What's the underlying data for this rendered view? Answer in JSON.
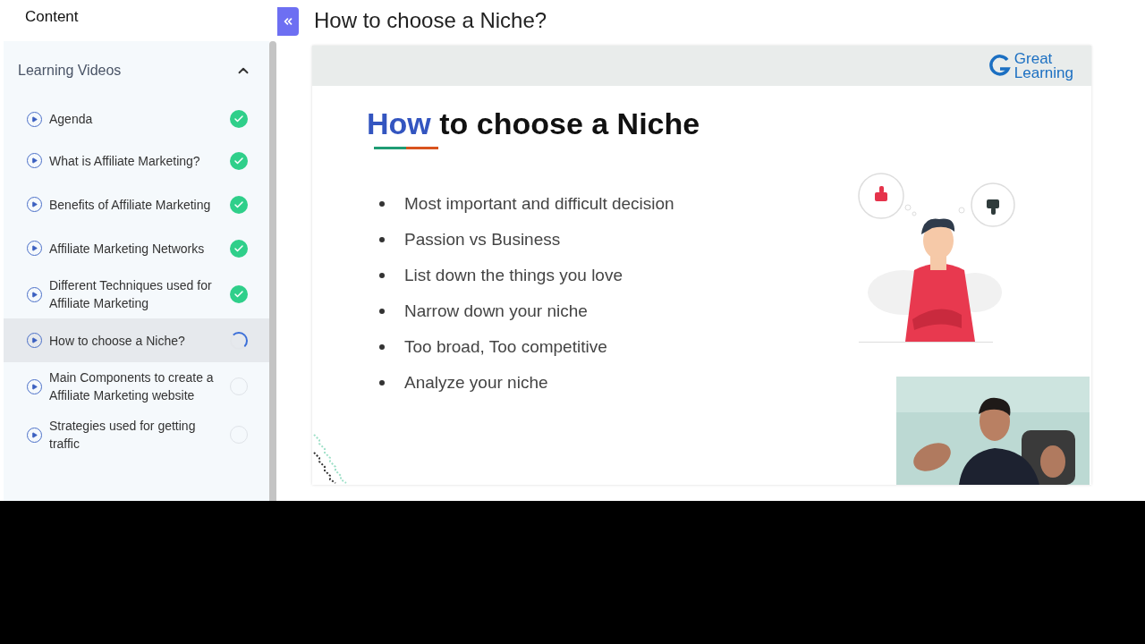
{
  "sidebar": {
    "title": "Content",
    "section": {
      "title": "Learning Videos",
      "expanded": true,
      "items": [
        {
          "label": "Agenda",
          "kind": "done",
          "selected": false
        },
        {
          "label": "What is Affiliate Marketing?",
          "kind": "done",
          "selected": false
        },
        {
          "label": "Benefits of Affiliate Marketing",
          "kind": "done",
          "selected": false
        },
        {
          "label": "Affiliate Marketing Networks",
          "kind": "done",
          "selected": false
        },
        {
          "label": "Different Techniques used for Affiliate Marketing",
          "kind": "done",
          "selected": false
        },
        {
          "label": "How to choose a Niche?",
          "kind": "loading",
          "selected": true
        },
        {
          "label": "Main Components to create a Affiliate Marketing website",
          "kind": "pending",
          "selected": false
        },
        {
          "label": "Strategies used for getting traffic",
          "kind": "pending",
          "selected": false
        }
      ]
    }
  },
  "lesson_title": "How to choose a Niche?",
  "slide": {
    "logo": {
      "line1": "Great",
      "line2": "Learning"
    },
    "heading": {
      "highlight": "How",
      "rest": "to choose a Niche"
    },
    "bullets": [
      "Most important and difficult decision",
      "Passion vs Business",
      "List down the things you love",
      "Narrow down your niche",
      "Too broad, Too competitive",
      "Analyze your niche"
    ]
  }
}
